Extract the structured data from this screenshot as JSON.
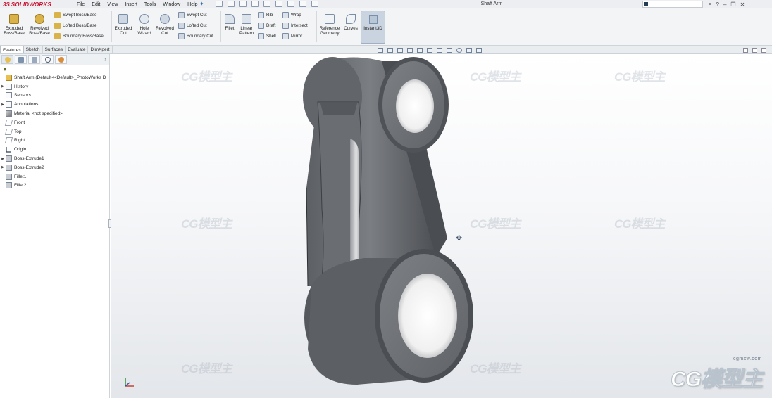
{
  "app": {
    "brand": "SOLIDWORKS",
    "document_title": "Shaft Arm",
    "menu": [
      "File",
      "Edit",
      "View",
      "Insert",
      "Tools",
      "Window",
      "Help"
    ]
  },
  "command_manager": {
    "extruded_boss": "Extruded Boss/Base",
    "revolved_boss": "Revolved Boss/Base",
    "swept_boss": "Swept Boss/Base",
    "lofted_boss": "Lofted Boss/Base",
    "boundary_boss": "Boundary Boss/Base",
    "extruded_cut": "Extruded Cut",
    "hole_wizard": "Hole Wizard",
    "revolved_cut": "Revolved Cut",
    "swept_cut": "Swept Cut",
    "lofted_cut": "Lofted Cut",
    "boundary_cut": "Boundary Cut",
    "fillet": "Fillet",
    "linear_pattern": "Linear Pattern",
    "rib": "Rib",
    "draft": "Draft",
    "shell": "Shell",
    "wrap": "Wrap",
    "intersect": "Intersect",
    "mirror": "Mirror",
    "reference_geometry": "Reference Geometry",
    "curves": "Curves",
    "instant3d": "Instant3D"
  },
  "tabs": [
    "Features",
    "Sketch",
    "Surfaces",
    "Evaluate",
    "DimXpert"
  ],
  "feature_tree": {
    "root": "Shaft Arm  (Default<<Default>_PhotoWorks D",
    "items": [
      {
        "label": "History",
        "kind": "folder",
        "expandable": true
      },
      {
        "label": "Sensors",
        "kind": "folder",
        "expandable": false
      },
      {
        "label": "Annotations",
        "kind": "folder",
        "expandable": true
      },
      {
        "label": "Material <not specified>",
        "kind": "material",
        "expandable": false
      },
      {
        "label": "Front",
        "kind": "plane",
        "expandable": false
      },
      {
        "label": "Top",
        "kind": "plane",
        "expandable": false
      },
      {
        "label": "Right",
        "kind": "plane",
        "expandable": false
      },
      {
        "label": "Origin",
        "kind": "origin",
        "expandable": false
      },
      {
        "label": "Boss-Extrude1",
        "kind": "feature",
        "expandable": true
      },
      {
        "label": "Boss-Extrude2",
        "kind": "feature",
        "expandable": true
      },
      {
        "label": "Fillet1",
        "kind": "feature",
        "expandable": false
      },
      {
        "label": "Fillet2",
        "kind": "feature",
        "expandable": false
      }
    ]
  },
  "watermark": {
    "text": "CG模型主",
    "url": "cgmxw.com"
  },
  "colors": {
    "brand_red": "#c8102e",
    "model_gray": "#6b6e72",
    "viewport_bottom": "#e3e6ea"
  }
}
